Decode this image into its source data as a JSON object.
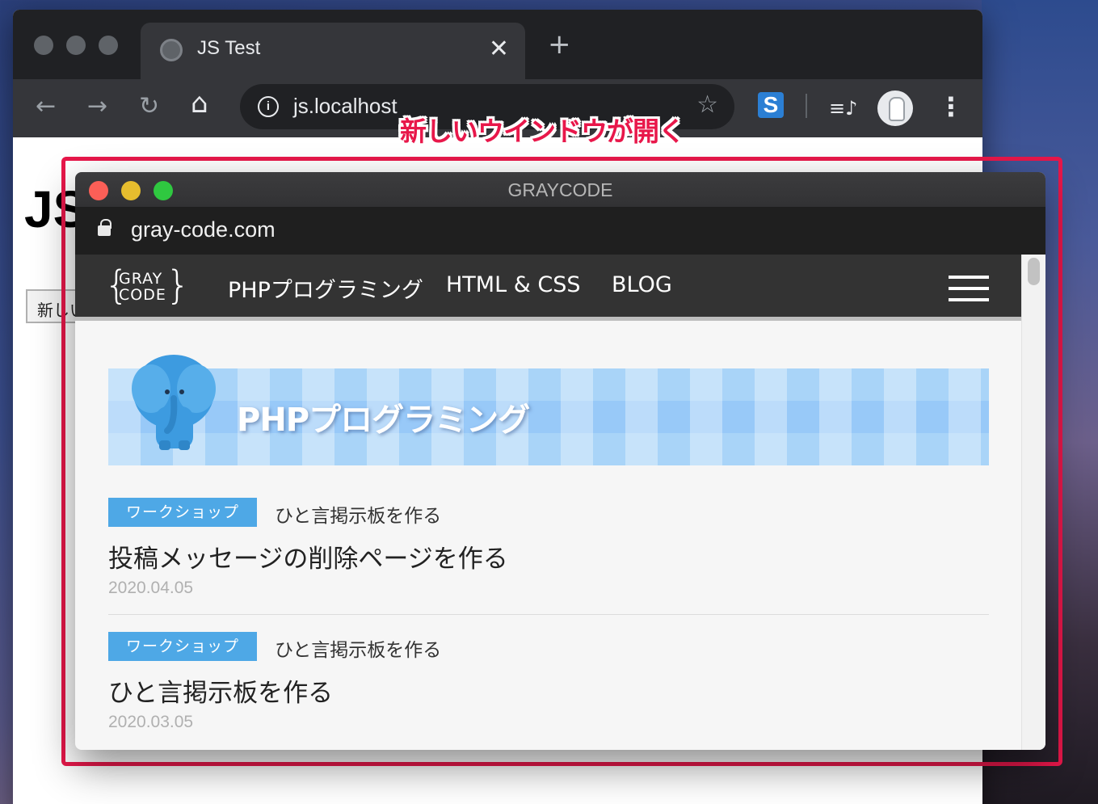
{
  "browser": {
    "tab_title": "JS Test",
    "tab_close": "✕",
    "new_tab": "+",
    "url": "js.localhost",
    "back": "←",
    "forward": "→",
    "reload": "↻",
    "home": "⌂",
    "star": "☆",
    "extension_label": "S",
    "media_icon": "≡♪",
    "menu": "⋮"
  },
  "page": {
    "heading": "JS",
    "button_label": "新しい"
  },
  "annotation": {
    "label": "新しいウインドウが開く",
    "color": "#e8174a"
  },
  "popup": {
    "title": "GRAYCODE",
    "url": "gray-code.com",
    "logo_line1": "GRAY",
    "logo_line2": "CODE",
    "nav": [
      {
        "label": "PHPプログラミング"
      },
      {
        "label": "HTML & CSS"
      },
      {
        "label": "BLOG"
      }
    ],
    "hero_title": "PHPプログラミング",
    "posts": [
      {
        "tag": "ワークショップ",
        "category": "ひと言掲示板を作る",
        "title": "投稿メッセージの削除ページを作る",
        "date": "2020.04.05"
      },
      {
        "tag": "ワークショップ",
        "category": "ひと言掲示板を作る",
        "title": "ひと言掲示板を作る",
        "date": "2020.03.05"
      }
    ],
    "colors": {
      "tag": "#4ea8e6",
      "nav_bg": "#333333",
      "close": "#fc5f57",
      "minimize": "#e6bd2e",
      "zoom": "#2fc840"
    }
  }
}
